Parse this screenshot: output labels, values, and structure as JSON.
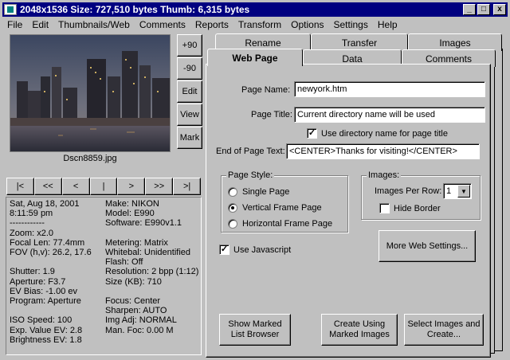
{
  "window": {
    "title": "2048x1536  Size: 727,510 bytes  Thumb: 6,315 bytes",
    "minimize": "_",
    "maximize": "□",
    "close": "x"
  },
  "menu": [
    "File",
    "Edit",
    "Thumbnails/Web",
    "Comments",
    "Reports",
    "Transform",
    "Options",
    "Settings",
    "Help"
  ],
  "image": {
    "filename": "Dscn8859.jpg"
  },
  "rotate_buttons": [
    "+90",
    "-90",
    "Edit",
    "View",
    "Mark"
  ],
  "nav_buttons": [
    "|<",
    "<<",
    "<",
    "|",
    ">",
    ">>",
    ">|"
  ],
  "exif": {
    "left": [
      "Sat, Aug 18, 2001",
      "8:11:59 pm",
      "------------",
      "Zoom: x2.0",
      "Focal Len: 77.4mm",
      "FOV (h,v): 26.2, 17.6",
      "",
      "Shutter: 1.9",
      "Aperture: F3.7",
      "EV Bias: -1.00 ev",
      "Program: Aperture",
      "",
      "ISO Speed: 100",
      "Exp. Value EV: 2.8",
      "Brightness EV: 1.8"
    ],
    "right": [
      "Make: NIKON",
      "Model: E990",
      "Software: E990v1.1",
      "",
      "Metering: Matrix",
      "Whitebal: Unidentified",
      "Flash: Off",
      "Resolution: 2 bpp (1:12)",
      "Size (KB): 710",
      "",
      "Focus: Center",
      "Sharpen: AUTO",
      "Img Adj: NORMAL",
      "Man. Foc: 0.00 M",
      ""
    ]
  },
  "tabs": {
    "row1": [
      "Rename",
      "Transfer",
      "Images"
    ],
    "row2": [
      "Web Page",
      "Data",
      "Comments"
    ],
    "active": "Web Page"
  },
  "webpage": {
    "page_name_label": "Page Name:",
    "page_name_value": "newyork.htm",
    "page_title_label": "Page Title:",
    "page_title_value": "Current directory name will be used",
    "use_dir_name_label": "Use directory name for page title",
    "use_dir_name_checked": true,
    "end_text_label": "End of Page Text:",
    "end_text_value": "<CENTER>Thanks for visiting!</CENTER>",
    "page_style": {
      "title": "Page Style:",
      "options": [
        "Single Page",
        "Vertical Frame Page",
        "Horizontal Frame Page"
      ],
      "selected": "Vertical Frame Page"
    },
    "images_group": {
      "title": "Images:",
      "per_row_label": "Images Per Row:",
      "per_row_value": "1",
      "hide_border_label": "Hide Border",
      "hide_border_checked": false
    },
    "use_javascript_label": "Use Javascript",
    "use_javascript_checked": true,
    "more_settings_label": "More Web Settings...",
    "show_marked_label": "Show Marked\nList Browser",
    "create_marked_label": "Create Using\nMarked Images",
    "select_images_label": "Select Images and\nCreate..."
  }
}
